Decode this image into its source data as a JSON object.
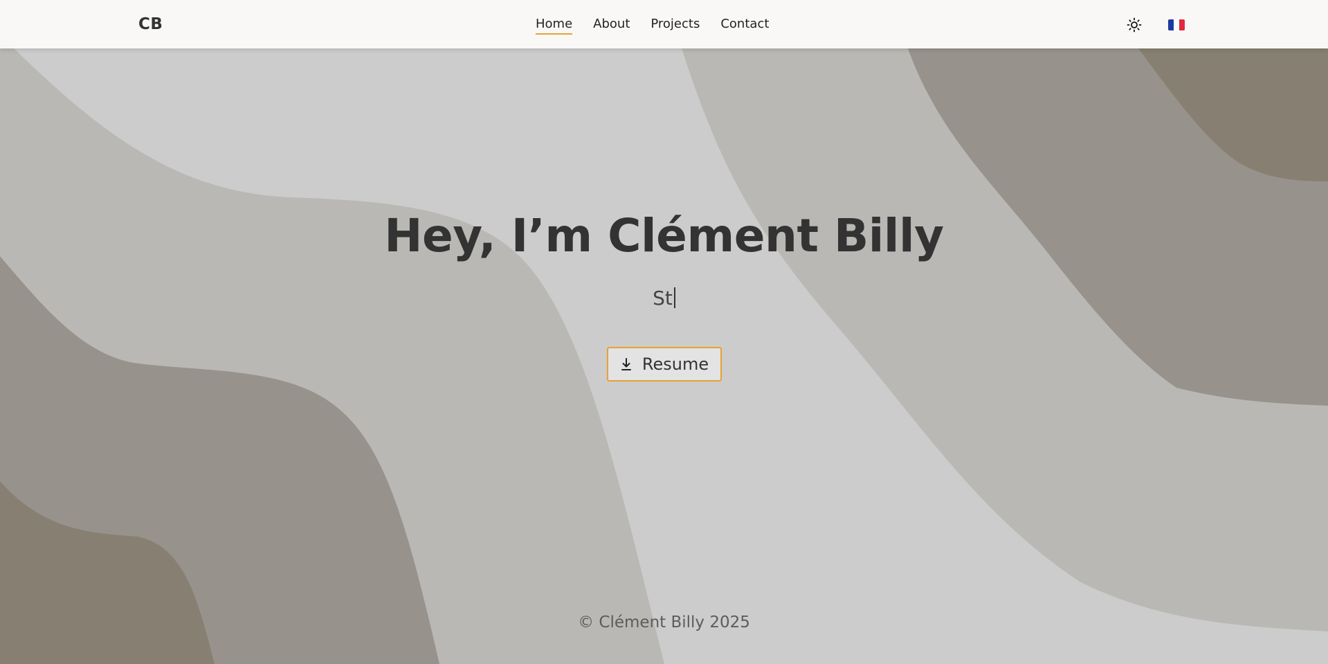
{
  "header": {
    "logo": "CB",
    "nav": [
      {
        "label": "Home",
        "active": true
      },
      {
        "label": "About",
        "active": false
      },
      {
        "label": "Projects",
        "active": false
      },
      {
        "label": "Contact",
        "active": false
      }
    ],
    "theme_icon": "sun-icon",
    "language_icon": "french-flag-icon"
  },
  "hero": {
    "title": "Hey, I’m Clément Billy",
    "typed_text": "St",
    "resume_label": "Resume",
    "resume_icon": "download-icon"
  },
  "footer": {
    "copyright": "© Clément Billy 2025"
  },
  "colors": {
    "accent": "#e8a133",
    "background": "#cccccc",
    "wave_light": "#b9b8b4",
    "wave_mid": "#97938c",
    "wave_dark": "#878072",
    "text": "#333333"
  }
}
